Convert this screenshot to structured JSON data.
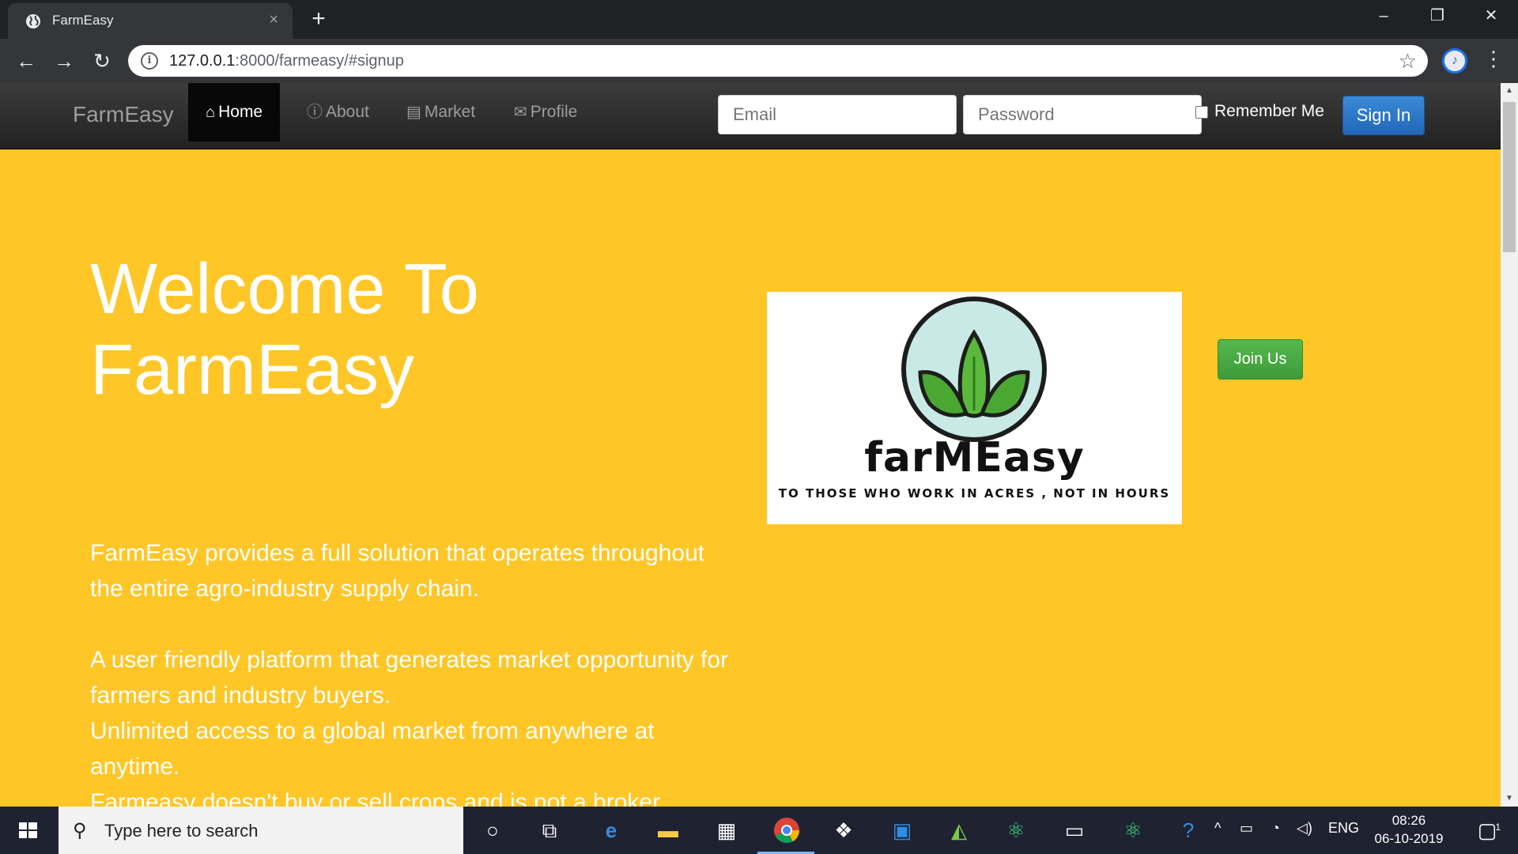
{
  "browser": {
    "tab_title": "FarmEasy",
    "tab_close": "×",
    "new_tab": "+",
    "url_host": "127.0.0.1",
    "url_rest": ":8000/farmeasy/#signup",
    "window_controls": {
      "minimize": "–",
      "restore": "❐",
      "close": "✕"
    },
    "nav": {
      "back": "←",
      "forward": "→",
      "reload": "↻"
    },
    "star": "☆",
    "menu": "⋮",
    "avatar": "♪"
  },
  "site_nav": {
    "brand": "FarmEasy",
    "items": [
      {
        "label": "Home",
        "icon": "home-icon",
        "glyph": "⌂"
      },
      {
        "label": "About",
        "icon": "info-icon",
        "glyph": "ⓘ"
      },
      {
        "label": "Market",
        "icon": "list-icon",
        "glyph": "▤"
      },
      {
        "label": "Profile",
        "icon": "envelope-icon",
        "glyph": "✉"
      }
    ],
    "email_placeholder": "Email",
    "password_placeholder": "Password",
    "remember_label": "Remember Me",
    "signin_label": "Sign In"
  },
  "hero": {
    "title_line1": "Welcome To",
    "title_line2": "FarmEasy",
    "logo_word": "farMEasy",
    "logo_tagline": "TO THOSE WHO WORK IN ACRES , NOT IN HOURS",
    "join_label": "Join Us",
    "paragraphs": [
      "FarmEasy provides a full solution that operates throughout the entire agro-industry supply chain.",
      "A user friendly platform that generates market opportunity for farmers and industry buyers.",
      "Unlimited access to a global market from anywhere at anytime.",
      "Farmeasy doesn't buy or sell crops and is not a broker."
    ]
  },
  "taskbar": {
    "search_placeholder": "Type here to search",
    "tray_lang": "ENG",
    "time": "08:26",
    "date": "06-10-2019",
    "notification_count": "1"
  },
  "colors": {
    "page_bg": "#ffc627",
    "navbar": "#222222",
    "signin": "#2a74c4",
    "join": "#4cae4c",
    "logo_green": "#5cb83c"
  }
}
